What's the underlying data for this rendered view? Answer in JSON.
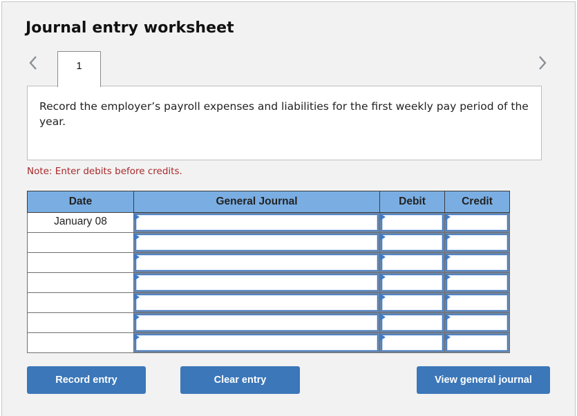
{
  "header": {
    "title": "Journal entry worksheet"
  },
  "navigation": {
    "prev_icon": "chevron-left-icon",
    "next_icon": "chevron-right-icon",
    "tabs": [
      {
        "label": "1",
        "active": true
      }
    ]
  },
  "instruction": {
    "text": "Record the employer’s payroll expenses and liabilities for the first weekly pay period of the year."
  },
  "note": {
    "text": "Note: Enter debits before credits."
  },
  "table": {
    "headers": {
      "date": "Date",
      "account": "General Journal",
      "debit": "Debit",
      "credit": "Credit"
    },
    "rows": [
      {
        "date": "January 08",
        "account": "",
        "debit": "",
        "credit": ""
      },
      {
        "date": "",
        "account": "",
        "debit": "",
        "credit": ""
      },
      {
        "date": "",
        "account": "",
        "debit": "",
        "credit": ""
      },
      {
        "date": "",
        "account": "",
        "debit": "",
        "credit": ""
      },
      {
        "date": "",
        "account": "",
        "debit": "",
        "credit": ""
      },
      {
        "date": "",
        "account": "",
        "debit": "",
        "credit": ""
      },
      {
        "date": "",
        "account": "",
        "debit": "",
        "credit": ""
      }
    ]
  },
  "buttons": {
    "record": "Record entry",
    "clear": "Clear entry",
    "view": "View general journal"
  },
  "colors": {
    "header_bg": "#7aaee3",
    "button_bg": "#3b77b9",
    "note_text": "#a8282a",
    "input_accent": "#3f7ac4"
  }
}
